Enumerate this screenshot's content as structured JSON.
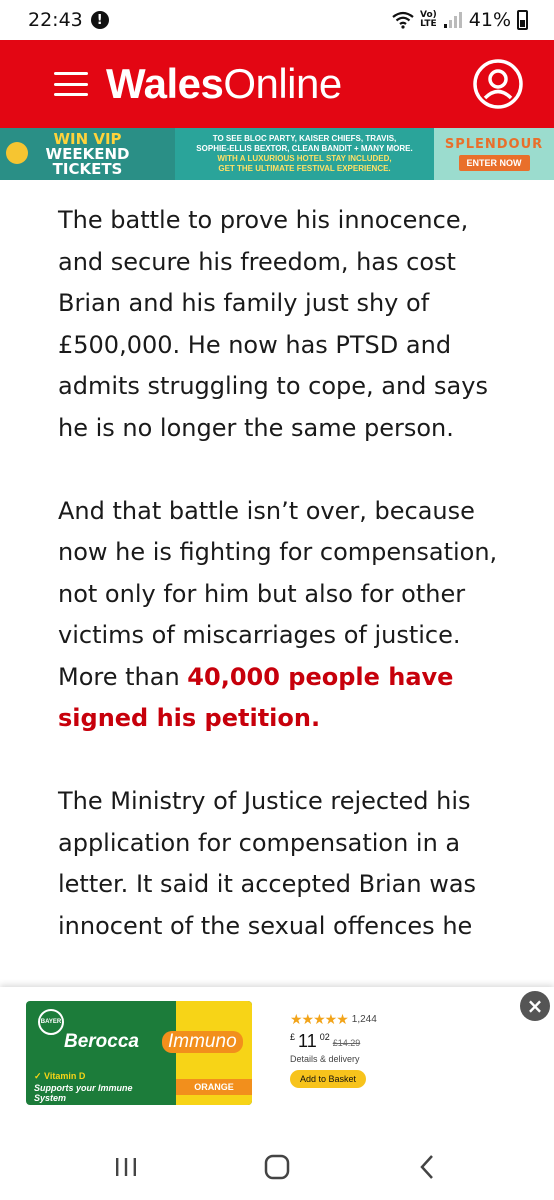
{
  "status_bar": {
    "time": "22:43",
    "alert_glyph": "!",
    "network_label_top": "Vo)",
    "network_label_bottom": "LTE",
    "battery": "41%",
    "icons": [
      "alert-icon",
      "wifi-icon",
      "volte-icon",
      "signal-icon",
      "battery-icon"
    ]
  },
  "header": {
    "brand_bold": "Wales",
    "brand_regular": "Online",
    "menu_icon": "menu-icon",
    "account_icon": "account-icon",
    "color": "#e30613"
  },
  "ad_banner": {
    "win_line1": "WIN VIP",
    "win_line2": "WEEKEND",
    "win_line3": "TICKETS",
    "line1": "TO SEE BLOC PARTY, KAISER CHIEFS, TRAVIS,",
    "line2": "SOPHIE-ELLIS BEXTOR, CLEAN BANDIT + MANY MORE.",
    "line3": "WITH A LUXURIOUS HOTEL STAY INCLUDED,",
    "line4": "GET THE ULTIMATE FESTIVAL EXPERIENCE.",
    "logo": "SPLENDOUR",
    "cta": "ENTER NOW"
  },
  "article": {
    "p1": "The battle to prove his innocence, and secure his freedom, has cost Brian and his family just shy of £500,000. He now has PTSD and admits struggling to cope, and says he is no longer the same person.",
    "p2_text": "And that battle isn’t over, because now he is fighting for compensation, not only for him but also for other victims of miscarriages of justice. More than ",
    "p2_link": "40,000 people have signed his petition.",
    "p3": "The Ministry of Justice rejected his application for compensation in a letter. It said it accepted Brian was innocent of the sexual offences he"
  },
  "bottom_ad": {
    "brand": "Berocca",
    "variant": "Immuno",
    "bayer": "BAYER",
    "vitamin": "✓ Vitamin D",
    "supports": "Supports your Immune System",
    "flavour": "ORANGE",
    "stars": "★★★★★",
    "rating_count": "1,244",
    "price_currency": "£",
    "price_main": "11",
    "price_pence": "02",
    "price_old": "£14.29",
    "delivery": "Details & delivery",
    "button": "Add to Basket",
    "close": "×"
  },
  "nav_bar": {
    "icons": [
      "recent-apps-icon",
      "home-icon",
      "back-icon"
    ]
  }
}
